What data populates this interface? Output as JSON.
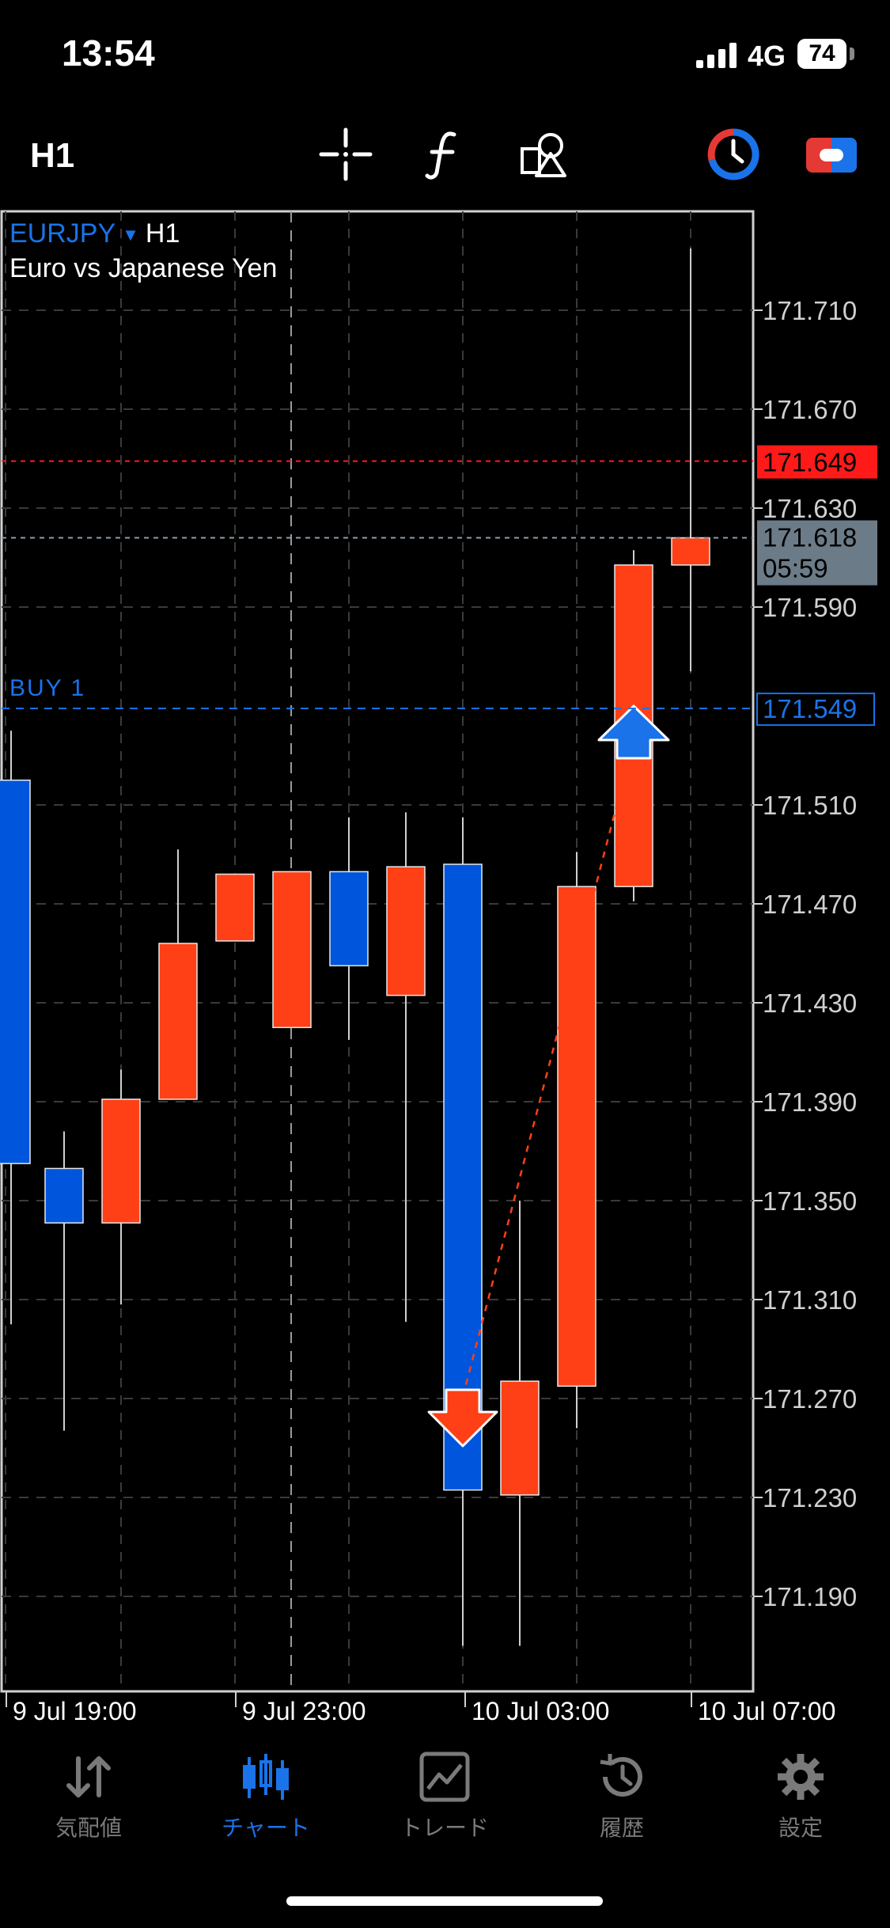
{
  "status": {
    "time": "13:54",
    "network": "4G",
    "battery": "74"
  },
  "toolbar": {
    "timeframe": "H1",
    "icons": [
      "crosshair-icon",
      "function-icon",
      "objects-icon",
      "timer-icon",
      "account-icon"
    ]
  },
  "chart": {
    "symbol": "EURJPY",
    "timeframe": "H1",
    "description": "Euro vs Japanese Yen",
    "price_ticks": [
      "171.710",
      "171.670",
      "171.630",
      "171.590",
      "171.510",
      "171.470",
      "171.430",
      "171.390",
      "171.350",
      "171.310",
      "171.270",
      "171.230",
      "171.190"
    ],
    "time_labels": [
      "9 Jul 19:00",
      "9 Jul 23:00",
      "10 Jul 03:00",
      "10 Jul 07:00"
    ],
    "ask_line": {
      "label": "171.649",
      "color": "#ff1a1a"
    },
    "bid_line": {
      "label": "171.618",
      "countdown": "05:59"
    },
    "position_line": {
      "text": "BUY 1",
      "label": "171.549",
      "color": "#1a73e8"
    },
    "colors": {
      "bull": "#0055dd",
      "bear": "#ff4016",
      "grid": "#3a3a3a"
    }
  },
  "chart_data": {
    "type": "candlestick",
    "symbol": "EURJPY",
    "timeframe": "H1",
    "ylim": [
      171.15,
      171.75
    ],
    "candles": [
      {
        "o": 171.365,
        "h": 171.54,
        "l": 171.3,
        "c": 171.52
      },
      {
        "o": 171.341,
        "h": 171.378,
        "l": 171.257,
        "c": 171.363
      },
      {
        "o": 171.391,
        "h": 171.403,
        "l": 171.308,
        "c": 171.341
      },
      {
        "o": 171.454,
        "h": 171.492,
        "l": 171.391,
        "c": 171.391
      },
      {
        "o": 171.482,
        "h": 171.482,
        "l": 171.455,
        "c": 171.455
      },
      {
        "o": 171.483,
        "h": 171.483,
        "l": 171.42,
        "c": 171.42
      },
      {
        "o": 171.445,
        "h": 171.505,
        "l": 171.415,
        "c": 171.483
      },
      {
        "o": 171.485,
        "h": 171.507,
        "l": 171.301,
        "c": 171.433
      },
      {
        "o": 171.233,
        "h": 171.505,
        "l": 171.17,
        "c": 171.486
      },
      {
        "o": 171.277,
        "h": 171.35,
        "l": 171.17,
        "c": 171.231
      },
      {
        "o": 171.477,
        "h": 171.491,
        "l": 171.258,
        "c": 171.275
      },
      {
        "o": 171.607,
        "h": 171.613,
        "l": 171.471,
        "c": 171.477
      },
      {
        "o": 171.618,
        "h": 171.735,
        "l": 171.564,
        "c": 171.607
      }
    ]
  },
  "nav": {
    "items": [
      {
        "label": "気配値",
        "icon": "quotes-icon"
      },
      {
        "label": "チャート",
        "icon": "chart-icon"
      },
      {
        "label": "トレード",
        "icon": "trade-icon"
      },
      {
        "label": "履歴",
        "icon": "history-icon"
      },
      {
        "label": "設定",
        "icon": "settings-icon"
      }
    ],
    "active_index": 1
  }
}
